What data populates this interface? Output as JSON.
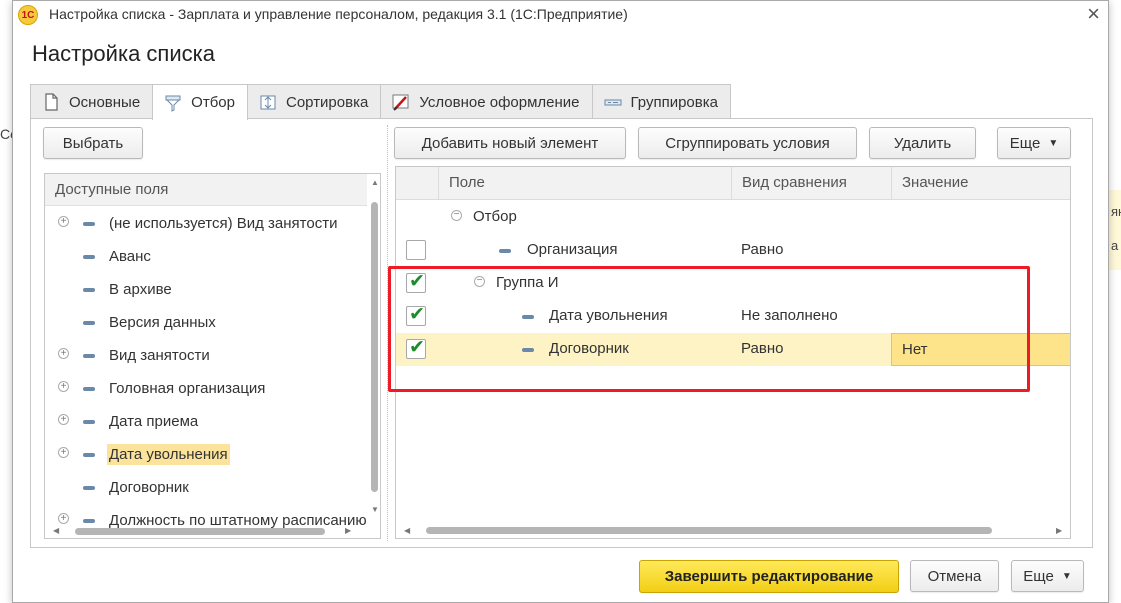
{
  "background": {
    "left_fragment": "Co",
    "right_fragment_1": "ян",
    "right_fragment_2": "a"
  },
  "window": {
    "title": "Настройка списка - Зарплата и управление персоналом, редакция 3.1  (1С:Предприятие)",
    "logo_text": "1С",
    "close_glyph": "×"
  },
  "form": {
    "title": "Настройка списка"
  },
  "tabs": [
    {
      "label": "Основные",
      "icon": "document-icon"
    },
    {
      "label": "Отбор",
      "icon": "filter-icon"
    },
    {
      "label": "Сортировка",
      "icon": "sort-icon"
    },
    {
      "label": "Условное оформление",
      "icon": "brush-icon"
    },
    {
      "label": "Группировка",
      "icon": "grouping-icon"
    }
  ],
  "left_panel": {
    "select_button": "Выбрать",
    "header": "Доступные поля",
    "fields": [
      {
        "label": "(не используется) Вид занятости",
        "expandable": true
      },
      {
        "label": "Аванс",
        "expandable": false
      },
      {
        "label": "В архиве",
        "expandable": false
      },
      {
        "label": "Версия данных",
        "expandable": false
      },
      {
        "label": "Вид занятости",
        "expandable": true
      },
      {
        "label": "Головная организация",
        "expandable": true
      },
      {
        "label": "Дата приема",
        "expandable": true
      },
      {
        "label": "Дата увольнения",
        "expandable": true,
        "highlighted": true
      },
      {
        "label": "Договорник",
        "expandable": false
      },
      {
        "label": "Должность по штатному расписанию",
        "expandable": true
      }
    ]
  },
  "toolbar": {
    "add_button": "Добавить новый элемент",
    "group_button": "Сгруппировать условия",
    "delete_button": "Удалить",
    "more_button": "Еще"
  },
  "grid": {
    "columns": [
      "Поле",
      "Вид сравнения",
      "Значение"
    ],
    "rows": [
      {
        "field": "Отбор",
        "comparison": "",
        "value": "",
        "checkbox": false,
        "checked": false
      },
      {
        "field": "Организация",
        "comparison": "Равно",
        "value": "",
        "checkbox": true,
        "checked": false
      },
      {
        "field": "Группа И",
        "comparison": "",
        "value": "",
        "checkbox": true,
        "checked": true
      },
      {
        "field": "Дата увольнения",
        "comparison": "Не заполнено",
        "value": "",
        "checkbox": true,
        "checked": true
      },
      {
        "field": "Договорник",
        "comparison": "Равно",
        "value": "Нет",
        "checkbox": true,
        "checked": true,
        "selected": true
      }
    ],
    "check_glyph": "✔"
  },
  "footer": {
    "finish_button": "Завершить редактирование",
    "cancel_button": "Отмена",
    "more_button": "Еще"
  },
  "colors": {
    "accent_yellow": "#f2cf14",
    "selection_row": "#fdf3c4",
    "highlight_frame": "#ef1b24",
    "check_green": "#1f8a2e"
  }
}
